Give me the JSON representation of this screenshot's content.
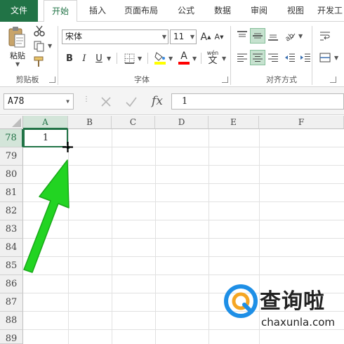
{
  "tabs": [
    {
      "key": "file",
      "label": "文件"
    },
    {
      "key": "home",
      "label": "开始"
    },
    {
      "key": "insert",
      "label": "插入"
    },
    {
      "key": "page_layout",
      "label": "页面布局"
    },
    {
      "key": "formulas",
      "label": "公式"
    },
    {
      "key": "data",
      "label": "数据"
    },
    {
      "key": "review",
      "label": "审阅"
    },
    {
      "key": "view",
      "label": "视图"
    },
    {
      "key": "developer",
      "label": "开发工"
    }
  ],
  "active_tab": "开始",
  "clipboard": {
    "group_label": "剪贴板",
    "paste_label": "粘贴",
    "icons": [
      "paste-icon",
      "cut-icon",
      "copy-icon",
      "format-painter-icon"
    ]
  },
  "font": {
    "group_label": "字体",
    "font_name": "宋体",
    "font_size": "11",
    "bold": "B",
    "italic": "I",
    "underline": "U",
    "increase_font": "A",
    "decrease_font": "A",
    "font_color_glyph": "A",
    "phonetic_top": "wén",
    "phonetic_bottom": "文",
    "fill_color": "#ffff00",
    "font_color": "#ff0000"
  },
  "alignment": {
    "group_label": "对齐方式"
  },
  "formula_bar": {
    "name_box": "A78",
    "fx_label": "fx",
    "formula_value": "1"
  },
  "grid": {
    "columns": [
      "A",
      "B",
      "C",
      "D",
      "E",
      "F"
    ],
    "selected_column": "A",
    "rows": [
      "78",
      "79",
      "80",
      "81",
      "82",
      "83",
      "84",
      "85",
      "86",
      "87",
      "88",
      "89"
    ],
    "selected_row": "78",
    "active_cell_value": "1"
  },
  "watermark": {
    "brand": "查询啦",
    "url": "chaxunla.com"
  },
  "colors": {
    "excel_green": "#217346",
    "annotation_arrow": "#22d422",
    "watermark_blue": "#1e8fe6",
    "watermark_orange": "#f5a623"
  }
}
